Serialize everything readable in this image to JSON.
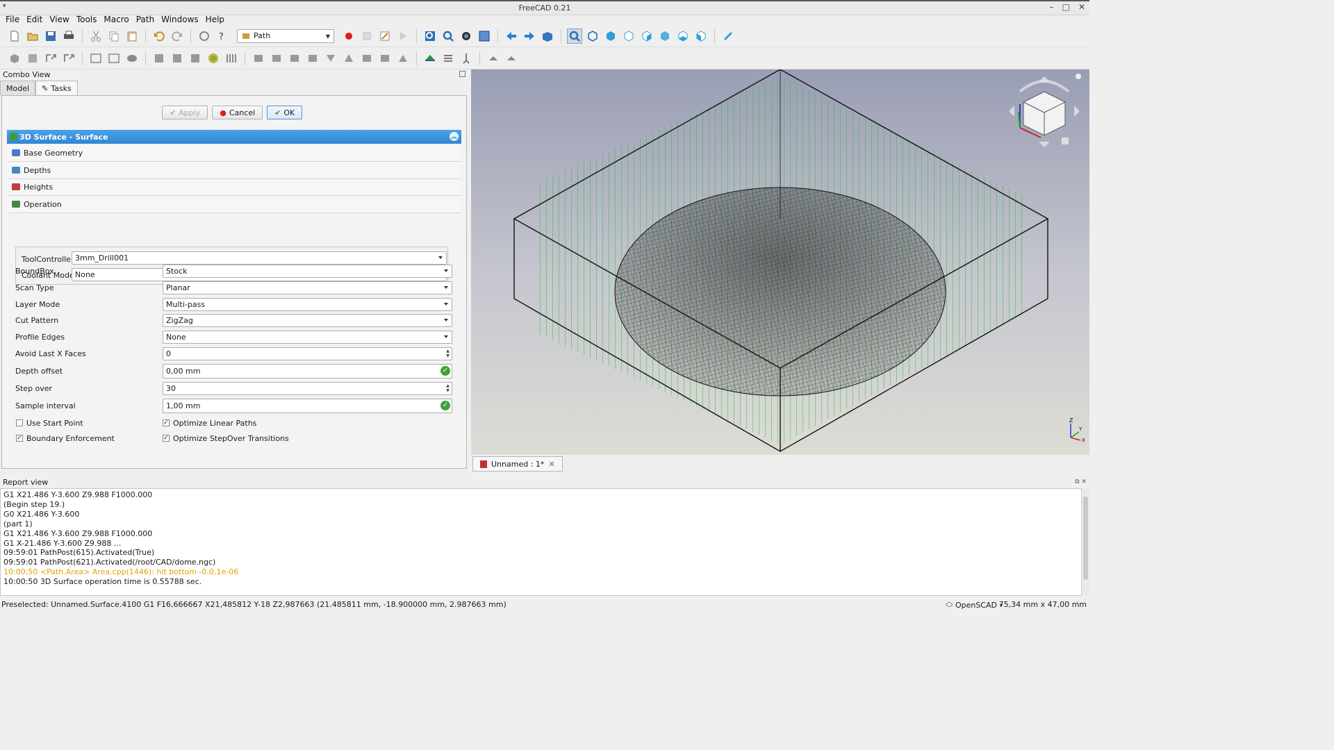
{
  "window": {
    "title": "FreeCAD 0.21"
  },
  "menu": [
    "File",
    "Edit",
    "View",
    "Tools",
    "Macro",
    "Path",
    "Windows",
    "Help"
  ],
  "workbench": {
    "selected": "Path"
  },
  "combo_view": {
    "title": "Combo View",
    "tabs": [
      "Model",
      "Tasks"
    ],
    "buttons": {
      "apply": "Apply",
      "cancel": "Cancel",
      "ok": "OK"
    },
    "panel_title": "3D Surface - Surface",
    "sections": [
      "Base Geometry",
      "Depths",
      "Heights",
      "Operation"
    ],
    "tool_controller": {
      "label": "ToolController",
      "value": "3mm_Drill001"
    },
    "coolant_mode": {
      "label": "Coolant Mode",
      "value": "None"
    },
    "fields": [
      {
        "label": "BoundBox",
        "value": "Stock"
      },
      {
        "label": "Scan Type",
        "value": "Planar"
      },
      {
        "label": "Layer Mode",
        "value": "Multi-pass"
      },
      {
        "label": "Cut Pattern",
        "value": "ZigZag"
      },
      {
        "label": "Profile Edges",
        "value": "None"
      },
      {
        "label": "Avoid Last X Faces",
        "value": "0"
      },
      {
        "label": "Depth offset",
        "value": "0,00 mm"
      },
      {
        "label": "Step over",
        "value": "30"
      },
      {
        "label": "Sample interval",
        "value": "1,00 mm"
      }
    ],
    "checkboxes": [
      {
        "label": "Use Start Point",
        "checked": false
      },
      {
        "label": "Optimize Linear Paths",
        "checked": true
      },
      {
        "label": "Boundary Enforcement",
        "checked": true
      },
      {
        "label": "Optimize StepOver Transitions",
        "checked": true
      }
    ]
  },
  "document_tab": "Unnamed : 1*",
  "report": {
    "title": "Report view",
    "lines": [
      "G1 X21.486 Y-3.600 Z9.988 F1000.000",
      "(Begin step 19.)",
      "G0 X21.486 Y-3.600",
      "(part 1)",
      "G1 X21.486 Y-3.600 Z9.988 F1000.000",
      "G1 X-21.486 Y-3.600 Z9.988 ...",
      "09:59:01  PathPost(615).Activated(True)",
      "09:59:01  PathPost(621).Activated(/root/CAD/dome.ngc)",
      "10:00:50  <Path.Area> Area.cpp(1446): hit bottom -0.0,1e-06",
      "10:00:50  3D Surface operation time is 0.55788 sec."
    ]
  },
  "status": {
    "message": "Preselected: Unnamed.Surface.4100 G1 F16,666667 X21,485812 Y-18 Z2,987663 (21.485811 mm, -18.900000 mm, 2.987663 mm)",
    "navigation": "OpenSCAD",
    "dimensions": "75,34 mm x 47,00 mm"
  },
  "axis_labels": {
    "z": "Z",
    "y": "Y",
    "x": "X"
  },
  "colors": {
    "toolpath": "#22cc22",
    "panel_header": "#3a95dd",
    "warning_text": "#e5a100"
  }
}
